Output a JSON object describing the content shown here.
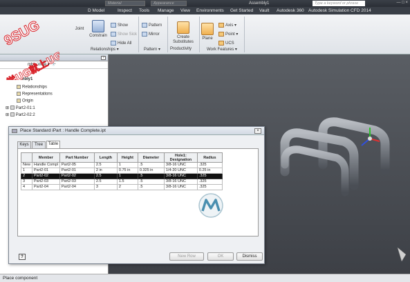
{
  "titlebar": {
    "material": "Material",
    "appearance": "Appearance",
    "title": "Assembly1",
    "search_placeholder": "Type a keyword or phrase",
    "window_controls": "— □ ×"
  },
  "menu": {
    "tabs": [
      "D Model",
      "Inspect",
      "Tools",
      "Manage",
      "View",
      "Environments",
      "Get Started",
      "Vault",
      "Autodesk 360",
      "Autodesk Simulation CFD 2014"
    ]
  },
  "ribbon": {
    "joint": "Joint",
    "constrain": "Constrain",
    "show": "Show",
    "show_sick": "Show Sick",
    "hide_all": "Hide All",
    "relationships": "Relationships",
    "pattern": "Pattern",
    "mirror": "Mirror",
    "pattern_group": "Pattern",
    "create_substitutes": "Create Substitutes",
    "productivity": "Productivity",
    "plane": "Plane",
    "axis": "Axis",
    "point": "Point",
    "ucs": "UCS",
    "work_features": "Work Features"
  },
  "browser": {
    "view_label": "mbly View",
    "items": [
      "mbly1",
      "Relationships",
      "Representations",
      "Origin",
      "Part2-01:1",
      "Part2-02:2"
    ]
  },
  "dialog": {
    "title": "Place Standard iPart : Handle Complete.ipt",
    "tabs": [
      "Keys",
      "Tree",
      "Table"
    ],
    "columns": [
      "",
      "Member",
      "Part Number",
      "Length",
      "Height",
      "Diameter",
      "Hole1: Designation",
      "Radius"
    ],
    "rows": [
      [
        "New",
        "Handle Compl",
        "Part2-05",
        "2.5",
        "1",
        ".5",
        "3/8-16 UNC",
        ".325"
      ],
      [
        "1",
        "Part2-01",
        "Part2-01",
        "2 in",
        "0.75 in",
        "0.325 in",
        "1/4-20 UNC",
        "0.25 in"
      ],
      [
        "2",
        "Part2-02",
        "Part2-02",
        "2.5",
        "1",
        ".5",
        "3/8-16 UNC",
        ".325"
      ],
      [
        "3",
        "Part2-03",
        "Part2-03",
        "2.5",
        "1.5",
        ".5",
        "3/8-16 UNC",
        ".325"
      ],
      [
        "4",
        "Part2-04",
        "Part2-04",
        "3",
        "2",
        ".5",
        "3/8-16 UNC",
        ".325"
      ]
    ],
    "selected_row": 2,
    "new_row": "New Row",
    "ok": "OK",
    "dismiss": "Dismiss",
    "help": "?"
  },
  "status": {
    "text": "Place component"
  },
  "watermark": {
    "line1": "9SUG",
    "line2": "学UG就上UG网"
  },
  "colors": {
    "watermark_red": "#d8232a",
    "viewport_bg": "#4a4d52",
    "selection": "#111111"
  }
}
